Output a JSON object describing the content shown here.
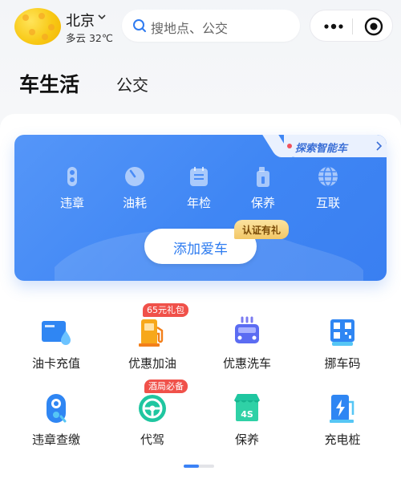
{
  "header": {
    "city": "北京",
    "weather": "多云 32℃",
    "search_placeholder": "搜地点、公交"
  },
  "tabs": [
    {
      "label": "车生活",
      "active": true
    },
    {
      "label": "公交",
      "active": false
    }
  ],
  "car_card": {
    "explore_label": "探索智能车",
    "features": [
      {
        "label": "违章",
        "icon": "violation-icon"
      },
      {
        "label": "油耗",
        "icon": "fuel-consumption-icon"
      },
      {
        "label": "年检",
        "icon": "annual-inspection-icon"
      },
      {
        "label": "保养",
        "icon": "maintenance-icon"
      },
      {
        "label": "互联",
        "icon": "globe-icon"
      }
    ],
    "add_car_label": "添加爱车",
    "promo_badge": "认证有礼"
  },
  "services": [
    {
      "label": "油卡充值",
      "icon": "fuel-card-icon",
      "badge": ""
    },
    {
      "label": "优惠加油",
      "icon": "gas-pump-icon",
      "badge": "65元礼包"
    },
    {
      "label": "优惠洗车",
      "icon": "car-wash-icon",
      "badge": ""
    },
    {
      "label": "挪车码",
      "icon": "qr-code-icon",
      "badge": ""
    },
    {
      "label": "违章查缴",
      "icon": "camera-icon",
      "badge": ""
    },
    {
      "label": "代驾",
      "icon": "steering-wheel-icon",
      "badge": "酒局必备"
    },
    {
      "label": "保养",
      "icon": "4s-store-icon",
      "badge": ""
    },
    {
      "label": "充电桩",
      "icon": "charging-pile-icon",
      "badge": ""
    }
  ],
  "colors": {
    "accent": "#3b82f6",
    "card_blue": "#4a8cf6",
    "badge_red": "#f0514a",
    "badge_gold": "#f3c766"
  },
  "pager": {
    "pages": 2,
    "current": 1
  }
}
